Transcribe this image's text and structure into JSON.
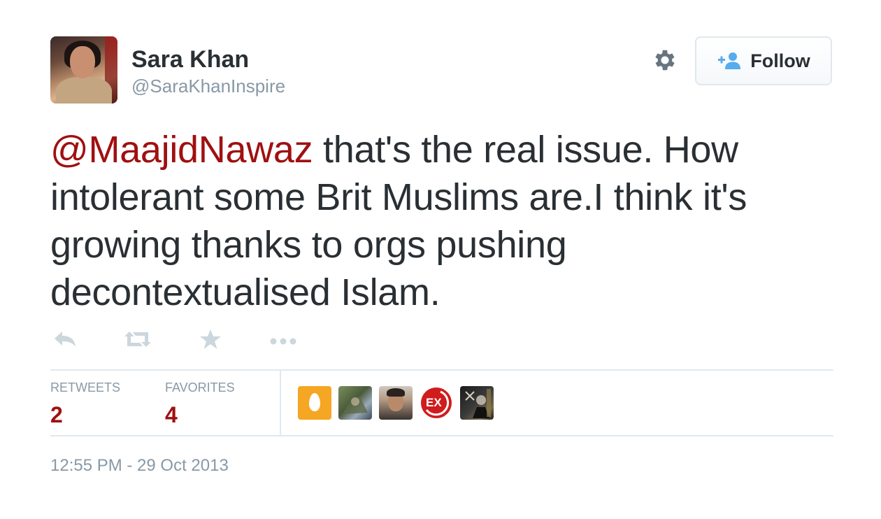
{
  "user": {
    "display_name": "Sara Khan",
    "screen_name": "@SaraKhanInspire",
    "avatar_icon": "profile-photo"
  },
  "header": {
    "settings_icon": "gear-icon",
    "follow_button": {
      "label": "Follow",
      "icon": "add-user-icon"
    }
  },
  "tweet": {
    "mention": "@MaajidNawaz",
    "text": " that's the real issue. How intolerant some Brit Muslims are.I think it's growing thanks to orgs pushing decontextualised Islam."
  },
  "actions": [
    {
      "name": "reply",
      "icon": "reply-icon"
    },
    {
      "name": "retweet",
      "icon": "retweet-icon"
    },
    {
      "name": "favorite",
      "icon": "star-icon"
    },
    {
      "name": "more",
      "icon": "more-dots-icon"
    }
  ],
  "stats": {
    "retweets_label": "RETWEETS",
    "retweets_count": "2",
    "favorites_label": "FAVORITES",
    "favorites_count": "4"
  },
  "favoriters": [
    {
      "icon": "default-egg-avatar"
    },
    {
      "icon": "user-avatar"
    },
    {
      "icon": "user-avatar"
    },
    {
      "icon": "ex-logo-avatar"
    },
    {
      "icon": "user-avatar"
    }
  ],
  "timestamp": "12:55 PM - 29 Oct 2013",
  "colors": {
    "text": "#292f33",
    "muted": "#8899a6",
    "link": "#a01010",
    "action_icon": "#ccd6dd",
    "divider": "#e1e8ed",
    "follow_icon": "#55acee"
  }
}
